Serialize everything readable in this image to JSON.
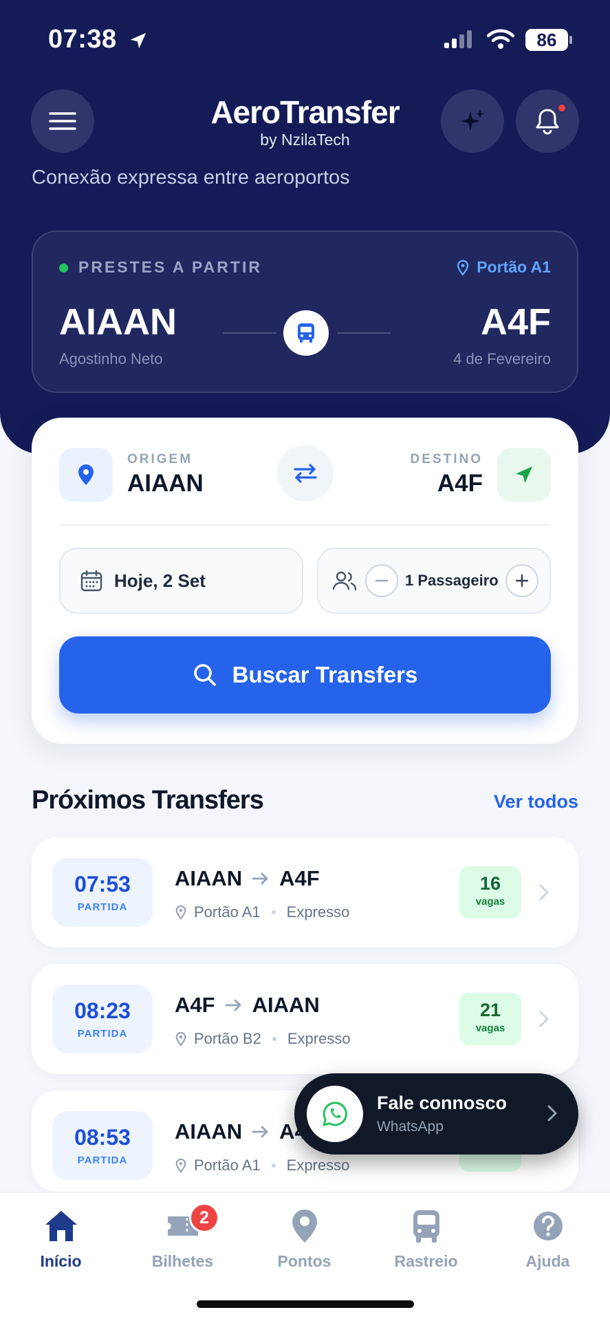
{
  "status_bar": {
    "time": "07:38",
    "battery": "86"
  },
  "header": {
    "title": "AeroTransfer",
    "subtitle": "by NzilaTech",
    "tagline": "Conexão expressa entre aeroportos"
  },
  "departing": {
    "label": "PRESTES A PARTIR",
    "gate": "Portão A1",
    "origin_code": "AIAAN",
    "origin_name": "Agostinho Neto",
    "destination_code": "A4F",
    "destination_name": "4 de Fevereiro"
  },
  "search": {
    "origin_label": "ORIGEM",
    "origin_value": "AIAAN",
    "destination_label": "DESTINO",
    "destination_value": "A4F",
    "date": "Hoje, 2 Set",
    "passengers": "1 Passageiro",
    "button": "Buscar Transfers"
  },
  "upcoming": {
    "title": "Próximos Transfers",
    "see_all": "Ver todos",
    "trips": [
      {
        "time": "07:53",
        "time_label": "PARTIDA",
        "from": "AIAAN",
        "to": "A4F",
        "gate": "Portão A1",
        "type": "Expresso",
        "seats": "16",
        "seats_label": "vagas"
      },
      {
        "time": "08:23",
        "time_label": "PARTIDA",
        "from": "A4F",
        "to": "AIAAN",
        "gate": "Portão B2",
        "type": "Expresso",
        "seats": "21",
        "seats_label": "vagas"
      },
      {
        "time": "08:53",
        "time_label": "PARTIDA",
        "from": "AIAAN",
        "to": "A4F",
        "gate": "Portão A1",
        "type": "Expresso",
        "seats": "",
        "seats_label": "vagas"
      }
    ]
  },
  "whatsapp": {
    "title": "Fale connosco",
    "subtitle": "WhatsApp"
  },
  "nav": {
    "items": [
      {
        "label": "Início",
        "icon": "home-icon"
      },
      {
        "label": "Bilhetes",
        "icon": "ticket-icon",
        "badge": "2"
      },
      {
        "label": "Pontos",
        "icon": "map-pin-icon"
      },
      {
        "label": "Rastreio",
        "icon": "bus-icon"
      },
      {
        "label": "Ajuda",
        "icon": "help-icon"
      }
    ]
  },
  "colors": {
    "hero": "#141b57",
    "primary": "#2563eb",
    "success": "#22c55e",
    "alert": "#ef4444"
  }
}
